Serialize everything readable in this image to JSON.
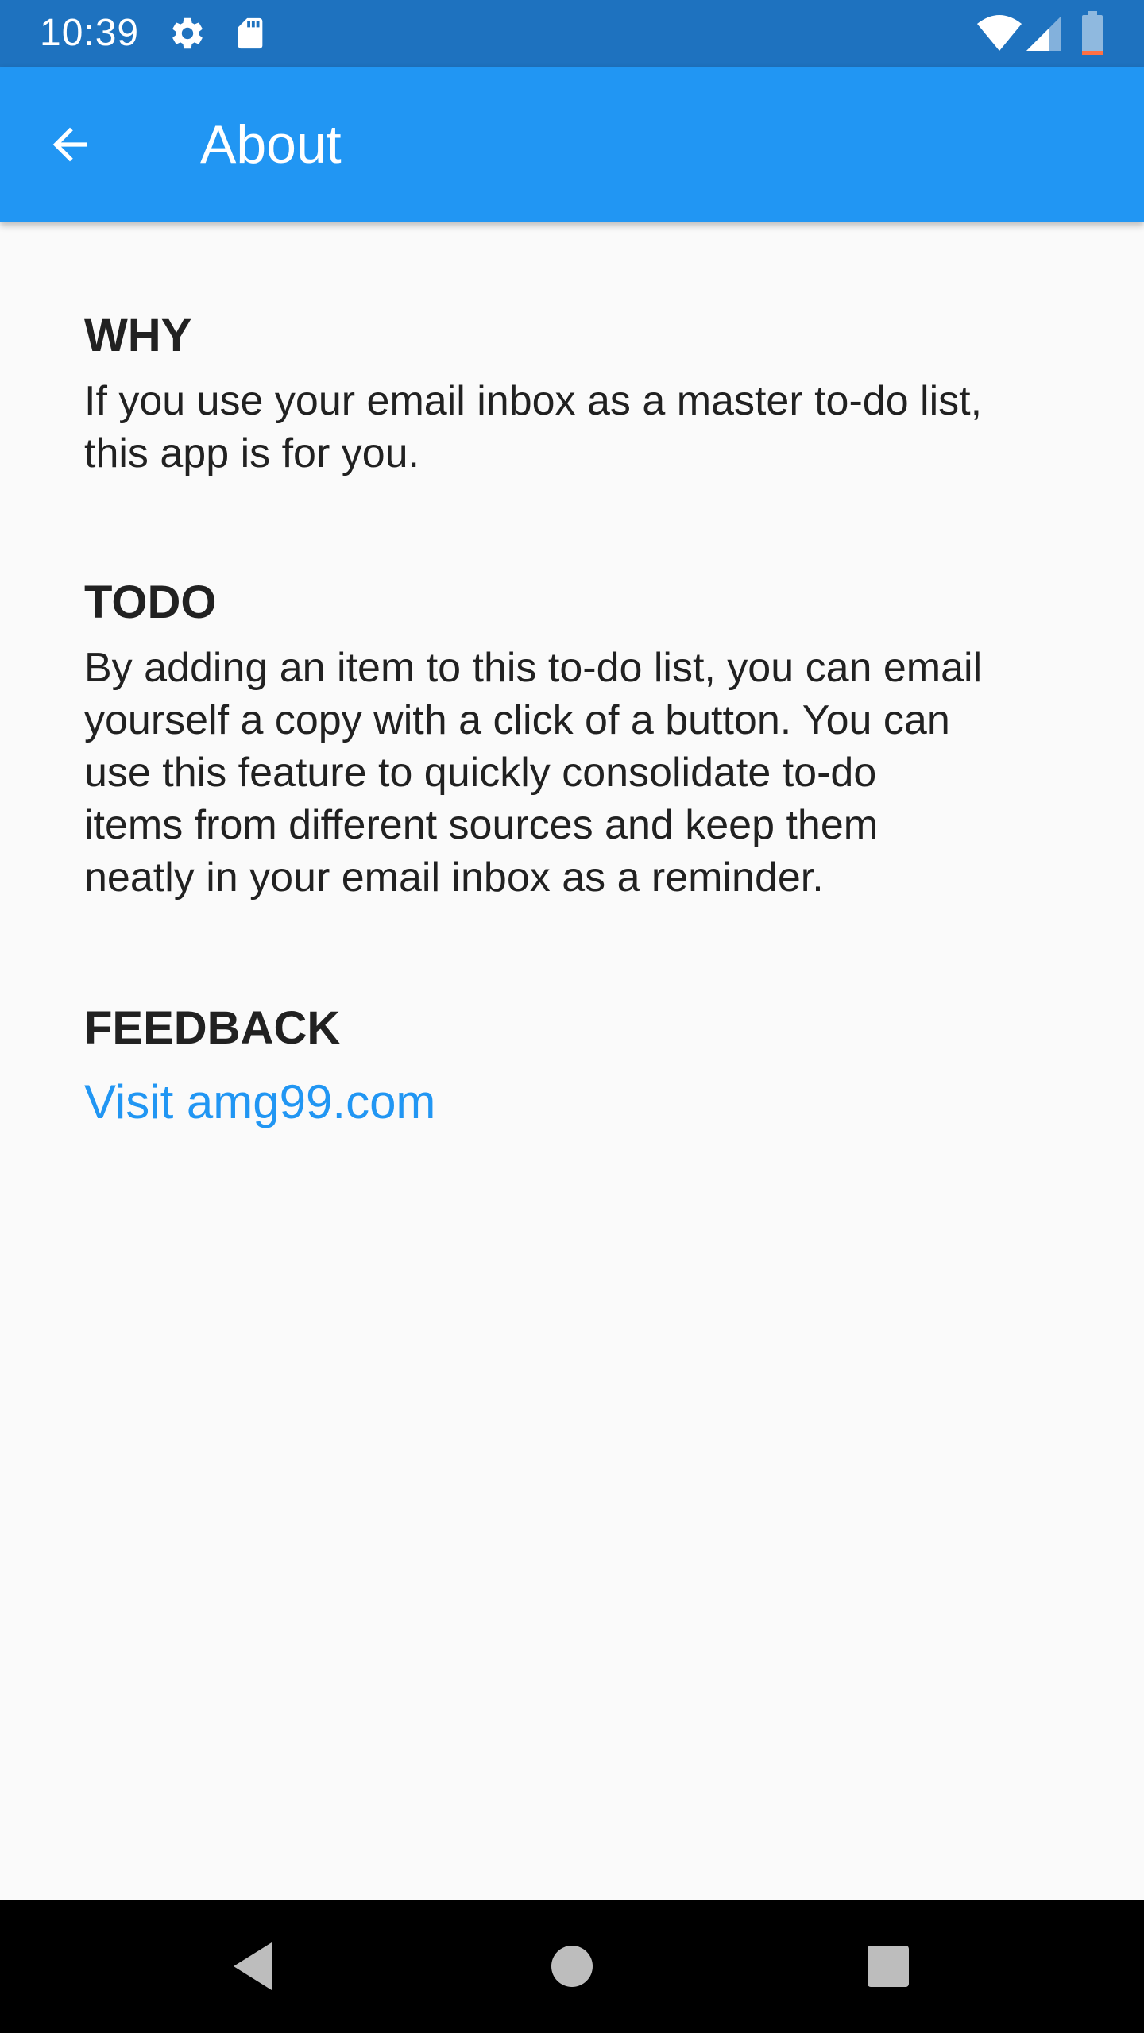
{
  "status_bar": {
    "time": "10:39",
    "icons": [
      "settings-gear-icon",
      "sd-card-icon",
      "wifi-icon",
      "cell-signal-icon",
      "battery-low-icon"
    ]
  },
  "app_bar": {
    "title": "About",
    "back_icon": "arrow-left-icon"
  },
  "sections": {
    "why": {
      "heading": "WHY",
      "body": "If you use your email inbox as a master to-do list,\nthis app is for you."
    },
    "todo": {
      "heading": "TODO",
      "body": "By adding an item to this to-do list, you can email\nyourself a copy with a click of a button.  You can\nuse this feature to quickly consolidate to-do\nitems from different sources and keep them\nneatly in your email inbox as a reminder."
    },
    "feedback": {
      "heading": "FEEDBACK",
      "link_text": "Visit amg99.com"
    }
  },
  "nav_bar": {
    "buttons": [
      "back-triangle-icon",
      "home-circle-icon",
      "recents-square-icon"
    ]
  },
  "colors": {
    "status_bar": "#1e72bf",
    "app_bar": "#2196f3",
    "link": "#2196f3",
    "text": "#212121",
    "background": "#fafafa"
  }
}
